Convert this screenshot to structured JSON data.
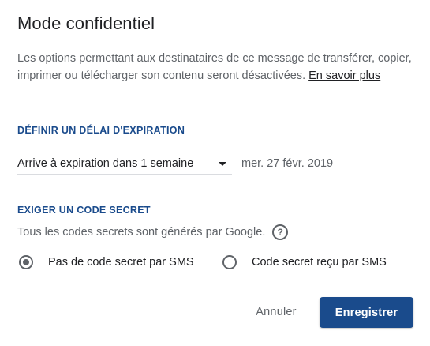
{
  "dialog": {
    "title": "Mode confidentiel",
    "description": "Les options permettant aux destinataires de ce message de transférer, copier, imprimer ou télécharger son contenu seront désactivées.",
    "learn_more_link": "En savoir plus"
  },
  "expiration": {
    "section_label": "DÉFINIR UN DÉLAI D'EXPIRATION",
    "selected_option": "Arrive à expiration dans 1 semaine",
    "expiry_date": "mer. 27 févr. 2019"
  },
  "passcode": {
    "section_label": "EXIGER UN CODE SECRET",
    "info_text": "Tous les codes secrets sont générés par Google.",
    "help_icon_glyph": "?",
    "options": [
      {
        "label": "Pas de code secret par SMS",
        "selected": true
      },
      {
        "label": "Code secret reçu par SMS",
        "selected": false
      }
    ]
  },
  "actions": {
    "cancel_label": "Annuler",
    "save_label": "Enregistrer"
  },
  "colors": {
    "accent": "#1a4b8c",
    "text_primary": "#202124",
    "text_secondary": "#5f6368"
  }
}
